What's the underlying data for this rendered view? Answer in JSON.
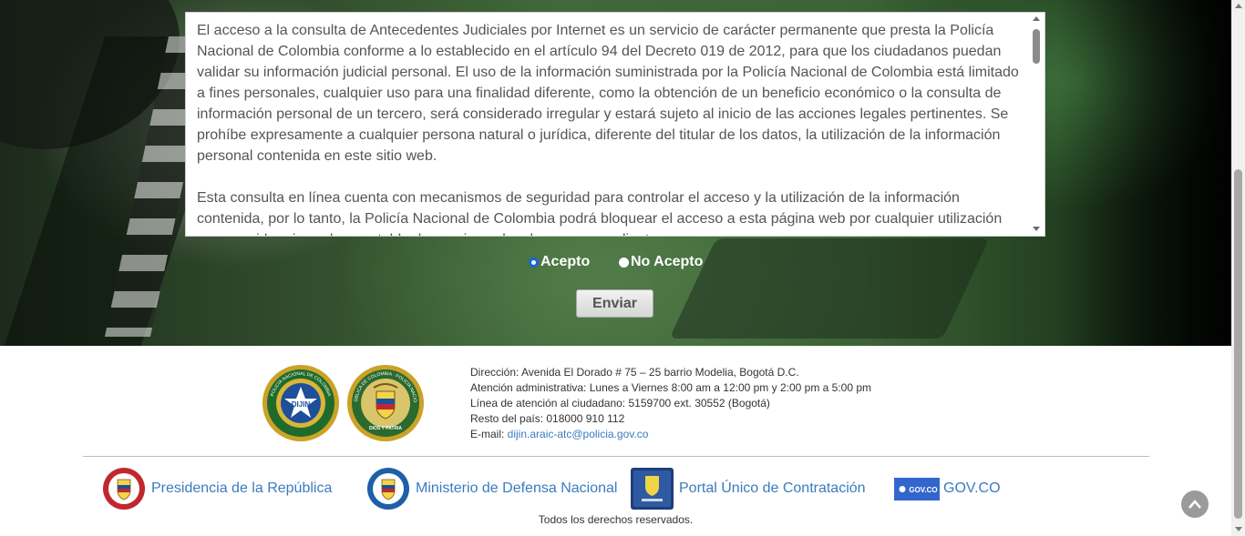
{
  "terms": {
    "paragraphs": [
      "El acceso a la consulta de Antecedentes Judiciales por Internet es un servicio de carácter permanente que presta la Policía Nacional de Colombia conforme a lo establecido en el artículo 94 del Decreto 019 de 2012, para que los ciudadanos puedan validar su información judicial personal. El uso de la información suministrada por la Policía Nacional de Colombia está limitado a fines personales, cualquier uso para una finalidad diferente, como la obtención de un beneficio económico o la consulta de información personal de un tercero, será considerado irregular y estará sujeto al inicio de las acciones legales pertinentes. Se prohíbe expresamente a cualquier persona natural o jurídica, diferente del titular de los datos, la utilización de la información personal contenida en este sitio web.",
      "Esta consulta en línea cuenta con mecanismos de seguridad para controlar el acceso y la utilización de la información contenida, por lo tanto, la Policía Nacional de Colombia podrá bloquear el acceso a esta página web por cualquier utilización que considere irregular y entablar las acciones legales correspondientes."
    ]
  },
  "consent": {
    "accept_label": "Acepto",
    "decline_label": "No Acepto",
    "selected": "Acepto"
  },
  "submit_label": "Enviar",
  "footer": {
    "logos": {
      "dijin": {
        "center_text": "DIJIN",
        "ring_text": "POLICÍA NACIONAL DE COLOMBIA"
      },
      "policia": {
        "ring_text": "REPÚBLICA DE COLOMBIA · POLICÍA NACIONAL",
        "motto": "DIOS Y PATRIA"
      }
    },
    "contact": {
      "address": "Dirección: Avenida El Dorado # 75 – 25 barrio Modelia, Bogotá D.C.",
      "hours": "Atención administrativa: Lunes a Viernes 8:00 am a 12:00 pm y 2:00 pm a 5:00 pm",
      "phone": "Línea de atención al ciudadano: 5159700 ext. 30552 (Bogotá)",
      "rest": "Resto del país: 018000 910 112",
      "email_label": "E-mail: ",
      "email": "dijin.araic-atc@policia.gov.co"
    },
    "links": [
      {
        "label": "Presidencia de la República",
        "icon": "presidencia-seal-icon"
      },
      {
        "label": "Ministerio de Defensa Nacional",
        "icon": "mindefensa-seal-icon"
      },
      {
        "label": "Portal Único de Contratación",
        "icon": "contratacion-icon"
      },
      {
        "label": "GOV.CO",
        "icon": "govco-logo-icon",
        "badge_text": "GOV.CO"
      }
    ],
    "rights": "Todos los derechos reservados."
  },
  "colors": {
    "link": "#3a7bbf",
    "hero_green": "#41683a",
    "radio_checked": "#1a66d2"
  }
}
